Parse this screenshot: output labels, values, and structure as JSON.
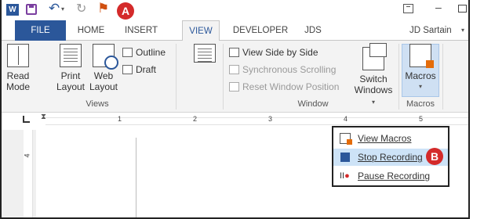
{
  "quick_access": {
    "app_icon_letter": "W",
    "badge_a": "A"
  },
  "tabs": {
    "file": "FILE",
    "home": "HOME",
    "insert": "INSERT",
    "view": "VIEW",
    "developer": "DEVELOPER",
    "jds": "JDS"
  },
  "user": {
    "name": "JD Sartain"
  },
  "ribbon": {
    "views_group": {
      "label": "Views",
      "read_mode": [
        "Read",
        "Mode"
      ],
      "print_layout": [
        "Print",
        "Layout"
      ],
      "web_layout": [
        "Web",
        "Layout"
      ],
      "outline": "Outline",
      "draft": "Draft"
    },
    "window_group": {
      "label": "Window",
      "view_side_by_side": "View Side by Side",
      "synchronous_scrolling": "Synchronous Scrolling",
      "reset_window_position": "Reset Window Position",
      "switch_windows": [
        "Switch",
        "Windows"
      ]
    },
    "macros_group": {
      "label": "Macros",
      "macros_button": "Macros"
    }
  },
  "ruler": {
    "numbers": [
      "1",
      "2",
      "3",
      "4",
      "5"
    ],
    "vertical_number": "4"
  },
  "macros_menu": {
    "view_macros": "View Macros",
    "stop_recording": "Stop Recording",
    "pause_recording": "Pause Recording",
    "badge_b": "B"
  },
  "colors": {
    "accent_blue": "#2b579a",
    "badge_red": "#d42a2a",
    "highlight": "#cde3f7"
  }
}
